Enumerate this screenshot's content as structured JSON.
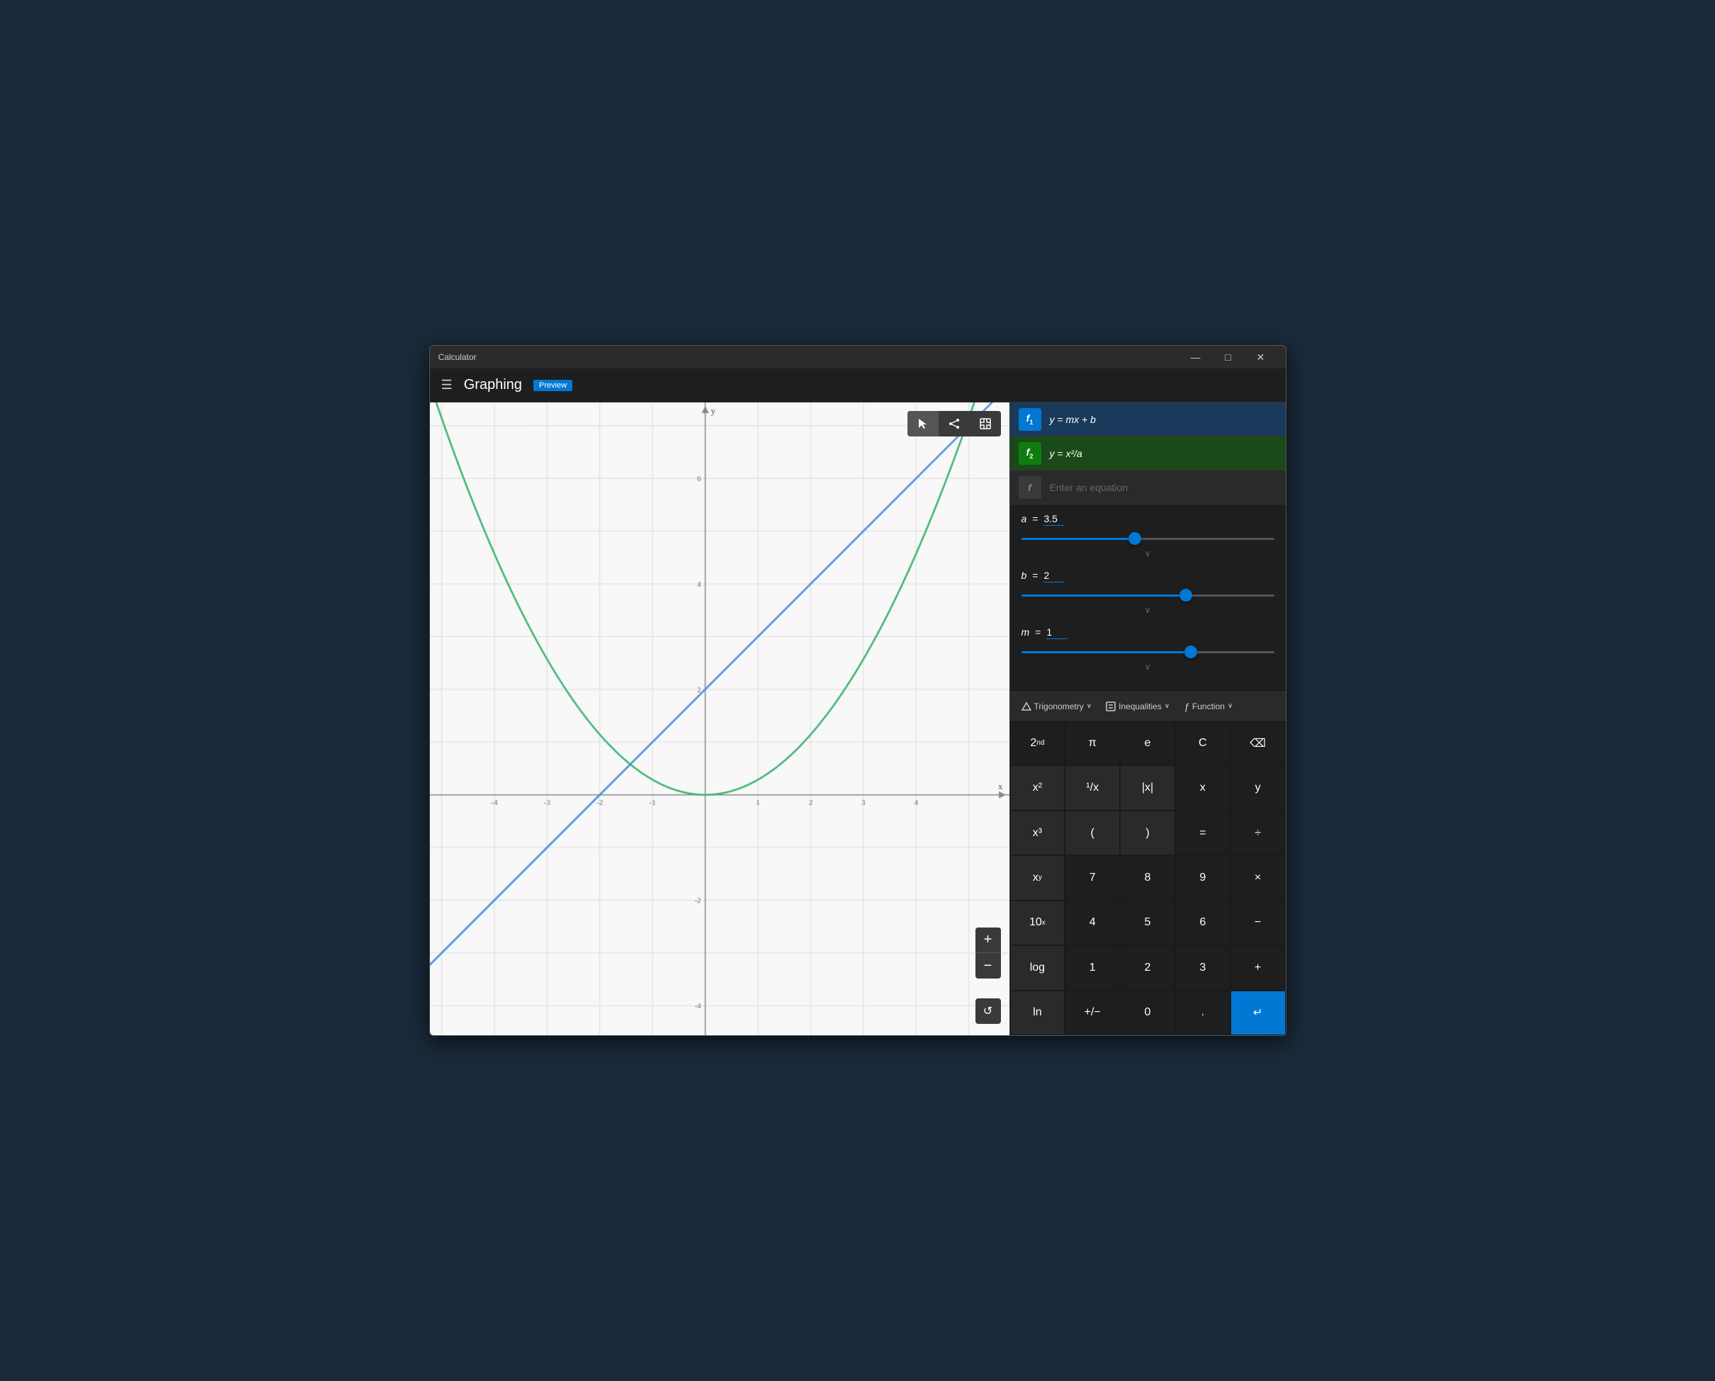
{
  "window": {
    "title": "Calculator",
    "controls": {
      "minimize": "—",
      "maximize": "□",
      "close": "✕"
    }
  },
  "header": {
    "title": "Graphing",
    "badge": "Preview"
  },
  "graph_toolbar": {
    "cursor_icon": "▷",
    "share_icon": "⤴",
    "expand_icon": "⛶"
  },
  "equations": [
    {
      "id": "f1",
      "label": "f",
      "subscript": "1",
      "color": "blue",
      "equation": "y = mx + b"
    },
    {
      "id": "f2",
      "label": "f",
      "subscript": "2",
      "color": "green",
      "equation": "y = x²/a"
    },
    {
      "id": "f3",
      "label": "f",
      "subscript": "",
      "color": "none",
      "placeholder": "Enter an equation"
    }
  ],
  "variables": [
    {
      "name": "a",
      "value": "3.5",
      "slider_position": 0.45
    },
    {
      "name": "b",
      "value": "2",
      "slider_position": 0.65
    },
    {
      "name": "m",
      "value": "1",
      "slider_position": 0.67
    }
  ],
  "keypad_header": [
    {
      "icon": "△",
      "label": "Trigonometry",
      "has_chevron": true
    },
    {
      "icon": "⊡",
      "label": "Inequalities",
      "has_chevron": true
    },
    {
      "icon": "ƒ",
      "label": "Function",
      "has_chevron": true
    }
  ],
  "keys": [
    {
      "label": "2nd",
      "superscript": "nd",
      "type": "dark",
      "id": "2nd"
    },
    {
      "label": "π",
      "type": "dark",
      "id": "pi"
    },
    {
      "label": "e",
      "type": "dark",
      "id": "e"
    },
    {
      "label": "C",
      "type": "dark",
      "id": "clear"
    },
    {
      "label": "⌫",
      "type": "dark",
      "id": "backspace"
    },
    {
      "label": "x²",
      "type": "normal",
      "id": "x-squared"
    },
    {
      "label": "¹/x",
      "type": "normal",
      "id": "reciprocal"
    },
    {
      "label": "|x|",
      "type": "normal",
      "id": "abs"
    },
    {
      "label": "x",
      "type": "dark",
      "id": "x"
    },
    {
      "label": "y",
      "type": "dark",
      "id": "y"
    },
    {
      "label": "x³",
      "type": "normal",
      "id": "x-cubed"
    },
    {
      "label": "(",
      "type": "normal",
      "id": "open-paren"
    },
    {
      "label": ")",
      "type": "normal",
      "id": "close-paren"
    },
    {
      "label": "=",
      "type": "dark",
      "id": "equals"
    },
    {
      "label": "÷",
      "type": "dark",
      "id": "divide"
    },
    {
      "label": "xʸ",
      "type": "normal",
      "id": "x-to-y"
    },
    {
      "label": "7",
      "type": "dark",
      "id": "7"
    },
    {
      "label": "8",
      "type": "dark",
      "id": "8"
    },
    {
      "label": "9",
      "type": "dark",
      "id": "9"
    },
    {
      "label": "×",
      "type": "dark",
      "id": "multiply"
    },
    {
      "label": "10ˣ",
      "type": "normal",
      "id": "10-to-x"
    },
    {
      "label": "4",
      "type": "dark",
      "id": "4"
    },
    {
      "label": "5",
      "type": "dark",
      "id": "5"
    },
    {
      "label": "6",
      "type": "dark",
      "id": "6"
    },
    {
      "label": "−",
      "type": "dark",
      "id": "subtract"
    },
    {
      "label": "log",
      "type": "normal",
      "id": "log"
    },
    {
      "label": "1",
      "type": "dark",
      "id": "1"
    },
    {
      "label": "2",
      "type": "dark",
      "id": "2"
    },
    {
      "label": "3",
      "type": "dark",
      "id": "3"
    },
    {
      "label": "+",
      "type": "dark",
      "id": "add"
    },
    {
      "label": "ln",
      "type": "normal",
      "id": "ln"
    },
    {
      "label": "+/−",
      "type": "dark",
      "id": "plus-minus"
    },
    {
      "label": "0",
      "type": "dark",
      "id": "0"
    },
    {
      "label": ".",
      "type": "dark",
      "id": "decimal"
    },
    {
      "label": "↵",
      "type": "accent",
      "id": "enter"
    }
  ],
  "zoom": {
    "plus": "+",
    "minus": "−",
    "reset": "↺"
  },
  "colors": {
    "blue_line": "#4a90d9",
    "green_line": "#3cb371",
    "axis": "#666",
    "grid": "#ddd",
    "background": "#f8f8f8"
  }
}
